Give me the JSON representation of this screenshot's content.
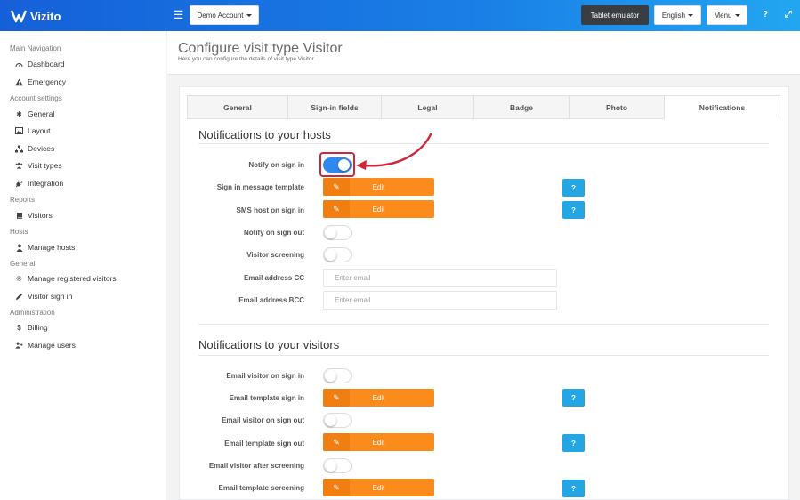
{
  "app": {
    "name": "Vizito"
  },
  "topbar": {
    "account_label": "Demo Account",
    "tablet_label": "Tablet emulator",
    "language_label": "English",
    "menu_label": "Menu",
    "help_glyph": "?",
    "expand_glyph": "⤢"
  },
  "sidebar": {
    "sections": [
      {
        "heading": "Main Navigation",
        "items": [
          {
            "label": "Dashboard",
            "icon": "dashboard-icon"
          },
          {
            "label": "Emergency",
            "icon": "warning-icon"
          }
        ]
      },
      {
        "heading": "Account settings",
        "items": [
          {
            "label": "General",
            "icon": "gear-icon"
          },
          {
            "label": "Layout",
            "icon": "image-icon"
          },
          {
            "label": "Devices",
            "icon": "sitemap-icon"
          },
          {
            "label": "Visit types",
            "icon": "users-icon"
          },
          {
            "label": "Integration",
            "icon": "plug-icon"
          }
        ]
      },
      {
        "heading": "Reports",
        "items": [
          {
            "label": "Visitors",
            "icon": "book-icon"
          }
        ]
      },
      {
        "heading": "Hosts",
        "items": [
          {
            "label": "Manage hosts",
            "icon": "user-icon"
          }
        ]
      },
      {
        "heading": "General",
        "items": [
          {
            "label": "Manage registered visitors",
            "icon": "registered-icon"
          },
          {
            "label": "Visitor sign in",
            "icon": "pencil-icon"
          }
        ]
      },
      {
        "heading": "Administration",
        "items": [
          {
            "label": "Billing",
            "icon": "dollar-icon"
          },
          {
            "label": "Manage users",
            "icon": "add-user-icon"
          }
        ]
      }
    ]
  },
  "page": {
    "title": "Configure visit type Visitor",
    "subtitle": "Here you can configure the details of visit type Visitor"
  },
  "tabs": [
    {
      "label": "General",
      "active": false
    },
    {
      "label": "Sign-in fields",
      "active": false
    },
    {
      "label": "Legal",
      "active": false
    },
    {
      "label": "Badge",
      "active": false
    },
    {
      "label": "Photo",
      "active": false
    },
    {
      "label": "Notifications",
      "active": true
    }
  ],
  "hosts_section": {
    "title": "Notifications to your hosts",
    "rows": [
      {
        "label": "Notify on sign in",
        "type": "toggle",
        "on": true
      },
      {
        "label": "Sign in message template",
        "type": "edit",
        "button": "Edit",
        "help": "?"
      },
      {
        "label": "SMS host on sign in",
        "type": "edit",
        "button": "Edit",
        "help": "?"
      },
      {
        "label": "Notify on sign out",
        "type": "toggle",
        "on": false
      },
      {
        "label": "Visitor screening",
        "type": "toggle",
        "on": false
      },
      {
        "label": "Email address CC",
        "type": "input",
        "placeholder": "Enter email",
        "value": ""
      },
      {
        "label": "Email address BCC",
        "type": "input",
        "placeholder": "Enter email",
        "value": ""
      }
    ]
  },
  "visitors_section": {
    "title": "Notifications to your visitors",
    "rows": [
      {
        "label": "Email visitor on sign in",
        "type": "toggle",
        "on": false
      },
      {
        "label": "Email template sign in",
        "type": "edit",
        "button": "Edit",
        "help": "?"
      },
      {
        "label": "Email visitor on sign out",
        "type": "toggle",
        "on": false
      },
      {
        "label": "Email template sign out",
        "type": "edit",
        "button": "Edit",
        "help": "?"
      },
      {
        "label": "Email visitor after screening",
        "type": "toggle",
        "on": false
      },
      {
        "label": "Email template screening",
        "type": "edit",
        "button": "Edit",
        "help": "?"
      }
    ]
  },
  "colors": {
    "topbar_start": "#1560d8",
    "topbar_end": "#23a6f0",
    "toggle_on": "#2f88f0",
    "edit_button": "#fb8c1c",
    "help_button": "#23a6e3",
    "highlight": "#d0263a"
  }
}
